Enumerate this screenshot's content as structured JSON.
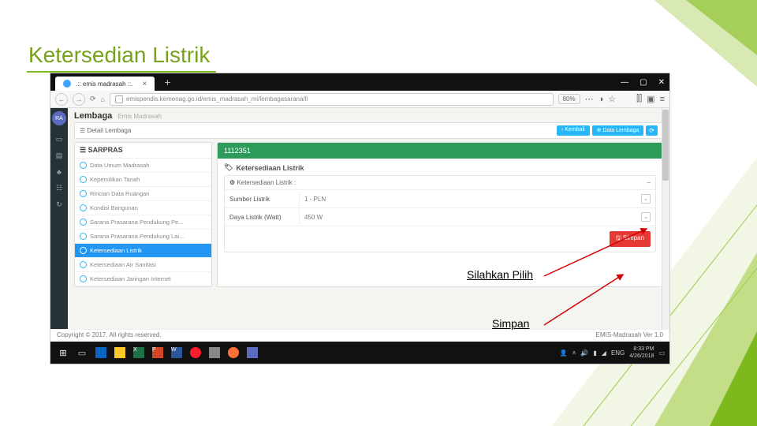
{
  "title": "Ketersedian Listrik",
  "browser": {
    "tab_title": ".:: emis madrasah ::.",
    "url": "emispendis.kemenag.go.id/emis_madrasah_mi/lembagasarana/li",
    "zoom": "80%"
  },
  "page": {
    "breadcrumb_main": "Lembaga",
    "breadcrumb_sub": "Emis Madrasah",
    "detail_label": "☰ Detail Lembaga",
    "btn_back": "‹ Kembali",
    "btn_data": "⊕ Data Lembaga",
    "sarpras_head": "☰ SARPRAS",
    "menu": [
      "Data Umum Madrasah",
      "Kepemilikan Tanah",
      "Rincian Data Ruangan",
      "Kondisi Bangunan",
      "Sarana Prasarana Pendukung Pe...",
      "Sarana Prasarana Pendukung Lai...",
      "Ketersediaan Listrik",
      "Ketersediaan Air Sanitasi",
      "Ketersediaan Jaringan Internet"
    ],
    "green_id": "1112351",
    "section_title": "Ketersediaan Listrik",
    "sub_title": "Ketersediaan Listrik :",
    "rows": [
      {
        "label": "Sumber Listrik",
        "value": "1 - PLN"
      },
      {
        "label": "Daya Listrik (Watt)",
        "value": "450 W"
      }
    ],
    "save": "🖫 Simpan",
    "copyright": "Copyright © 2017. All rights reserved.",
    "version": "EMIS-Madrasah Ver 1.0"
  },
  "taskbar": {
    "lang": "ENG",
    "time": "8:33 PM",
    "date": "4/26/2018"
  },
  "annotations": {
    "pilih": "Silahkan Pilih",
    "simpan": "Simpan"
  }
}
